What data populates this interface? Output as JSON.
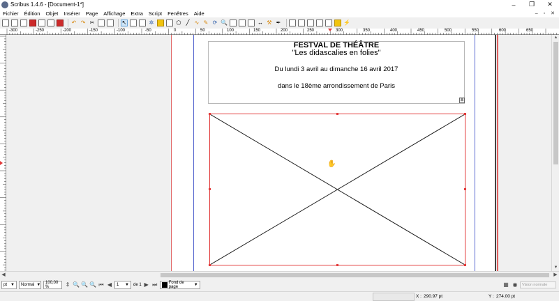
{
  "window": {
    "title": "Scribus 1.4.6 - [Document-1*]",
    "minimize": "–",
    "maximize": "❐",
    "close": "✕"
  },
  "menu": {
    "items": [
      "Fichier",
      "Édition",
      "Objet",
      "Insérer",
      "Page",
      "Affichage",
      "Extra",
      "Script",
      "Fenêtres",
      "Aide"
    ],
    "doc_controls": [
      "–",
      "▫",
      "✕"
    ]
  },
  "ruler": {
    "h_labels": [
      "-300",
      "-250",
      "-200",
      "-150",
      "-100",
      "-50",
      "0",
      "50",
      "100",
      "150",
      "200",
      "250",
      "300",
      "350",
      "400",
      "450",
      "500",
      "550",
      "600",
      "650"
    ],
    "v_labels": [
      "-50",
      "0",
      "50",
      "100",
      "150",
      "200",
      "250",
      "300",
      "350",
      "400"
    ]
  },
  "document": {
    "text_frame": {
      "line1": "FESTVAL DE THÉÂTRE",
      "line2": "\"Les didascalies en folies\"",
      "line3": "Du lundi 3 avril au dimanche 16 avril 2017",
      "line4": "dans le 18ème arrondissement de Paris",
      "overflow_glyph": "⊠"
    },
    "cursor_glyph": "✋"
  },
  "statusbar": {
    "unit": "pt",
    "quality": "Normal",
    "zoom": "100,00 %",
    "page_value": "1",
    "page_of": "de 1",
    "layer": "Fond de page",
    "view_mode": "Vision normale"
  },
  "coords": {
    "x_label": "X :",
    "x_value": "290.97 pt",
    "y_label": "Y :",
    "y_value": "274.00 pt"
  },
  "colors": {
    "selection": "#e23a3a",
    "margin_guide": "#5a6ad0",
    "bleed_guide": "#e06060",
    "page_edge": "#444444"
  },
  "icons": {
    "new": "🗋",
    "open": "📂",
    "save": "💾",
    "close_doc": "✖",
    "print": "🖨",
    "preflight": "✔",
    "pdf": "📕",
    "undo": "↶",
    "redo": "↷",
    "cut": "✂",
    "copy": "⧉",
    "paste": "📋",
    "select": "↖",
    "textframe": "T",
    "imageframe": "▣",
    "render": "✲",
    "table": "▦",
    "shape": "■",
    "polygon": "⬠",
    "line": "╱",
    "bezier": "∿",
    "freehand": "✎",
    "rotate": "⟳",
    "zoom": "🔍",
    "edit": "✏",
    "link": "⛓",
    "unlink": "⛓",
    "measure": "↔",
    "copyprops": "⚒",
    "eyedropper": "✒",
    "pdf_button": "▭",
    "pdf_text": "▤",
    "pdf_check": "☑",
    "pdf_combo": "▥",
    "pdf_list": "▦",
    "pdf_annot": "▮",
    "pdf_link": "⚡"
  }
}
